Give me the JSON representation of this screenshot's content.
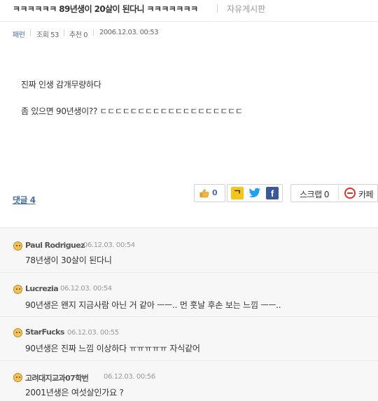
{
  "post": {
    "title": "ㅋㅋㅋㅋㅋㅋ 89년생이 20살이 된다니 ㅋㅋㅋㅋㅋㅋㅋ",
    "board": "자유게시판",
    "author": "패런",
    "views": "조회 53",
    "recommend": "추천 0",
    "date": "2006.12.03. 00:53",
    "body": [
      "진짜 인생 감개무량하다",
      "좀 있으면 90년생이?? ㄷㄷㄷㄷㄷㄷㄷㄷㄷㄷㄷㄷㄷㄷㄷㄷㄷㄷㄷ"
    ]
  },
  "actions": {
    "comments_link": "댓글 4",
    "like_count": "0",
    "kakao_letter": "ᄀ",
    "twitter_icon": "twitter-icon",
    "facebook_letter": "f",
    "scrap": "스크랩 0",
    "cafe": "카페"
  },
  "colors": {
    "link": "#4a6fa5",
    "kakao": "#f5c518",
    "twitter": "#1da1f2",
    "facebook": "#3b5998",
    "comments_bg": "#f7f7f7",
    "no_sign": "#e0322c"
  },
  "comments": [
    {
      "name": "Paul Rodriguez",
      "date": "06.12.03. 00:54",
      "text": "78년생이 30살이 된다니"
    },
    {
      "name": "Lucrezia",
      "date": "06.12.03. 00:54",
      "text": "90년생은 왠지 지금사람 아닌 거 같아 ㅡㅡ.. 먼 훗날 후손 보는 느낌 ㅡㅡ.."
    },
    {
      "name": "StarFucks",
      "date": "06.12.03. 00:55",
      "text": "90년생은 진짜 느낌 이상하다 ㅠㅠㅠㅠㅠ 자식같어"
    },
    {
      "name": "고려대지교과07학번",
      "date": "06.12.03. 00:56",
      "text": "2001년생은 여섯살인가요 ?"
    }
  ]
}
